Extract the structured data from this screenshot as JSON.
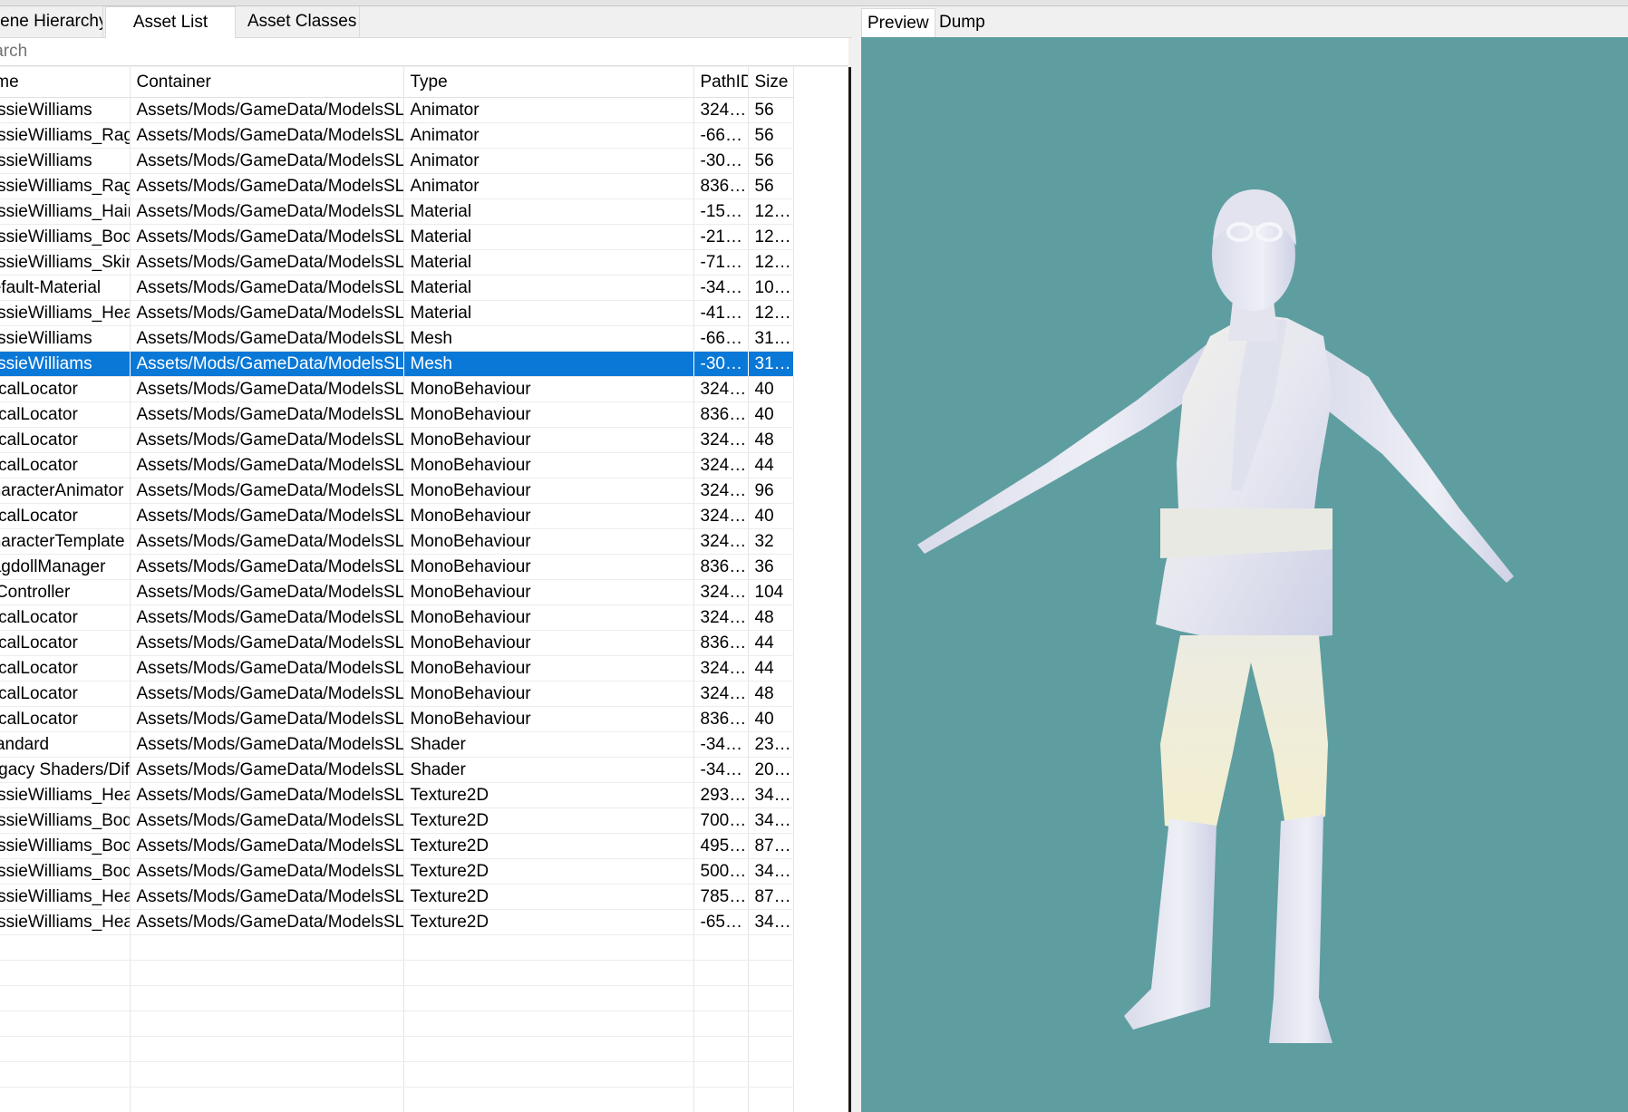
{
  "tabs": {
    "scene_hierarchy": "Scene Hierarchy",
    "asset_list": "Asset List",
    "asset_classes": "Asset Classes"
  },
  "search": {
    "placeholder": "Search"
  },
  "columns": {
    "name": "Name",
    "container": "Container",
    "type": "Type",
    "path_id": "PathID",
    "size": "Size"
  },
  "rows": [
    {
      "name": "JessieWilliams",
      "container": "Assets/Mods/GameData/ModelsSLOD",
      "type": "Animator",
      "path_id": "324…",
      "size": "56"
    },
    {
      "name": "JessieWilliams_Ragdoll",
      "container": "Assets/Mods/GameData/ModelsSLOD",
      "type": "Animator",
      "path_id": "-66…",
      "size": "56"
    },
    {
      "name": "JessieWilliams",
      "container": "Assets/Mods/GameData/ModelsSLOD",
      "type": "Animator",
      "path_id": "-30…",
      "size": "56"
    },
    {
      "name": "JessieWilliams_Ragdoll",
      "container": "Assets/Mods/GameData/ModelsSLOD",
      "type": "Animator",
      "path_id": "836…",
      "size": "56"
    },
    {
      "name": "JessieWilliams_Hair",
      "container": "Assets/Mods/GameData/ModelsSLOD",
      "type": "Material",
      "path_id": "-15…",
      "size": "12…"
    },
    {
      "name": "JessieWilliams_Body",
      "container": "Assets/Mods/GameData/ModelsSLOD",
      "type": "Material",
      "path_id": "-21…",
      "size": "12…"
    },
    {
      "name": "JessieWilliams_Skin",
      "container": "Assets/Mods/GameData/ModelsSLOD",
      "type": "Material",
      "path_id": "-71…",
      "size": "12…"
    },
    {
      "name": "Default-Material",
      "container": "Assets/Mods/GameData/ModelsSLOD",
      "type": "Material",
      "path_id": "-34…",
      "size": "10…"
    },
    {
      "name": "JessieWilliams_Head",
      "container": "Assets/Mods/GameData/ModelsSLOD",
      "type": "Material",
      "path_id": "-41…",
      "size": "12…"
    },
    {
      "name": "JessieWilliams",
      "container": "Assets/Mods/GameData/ModelsSLOD",
      "type": "Mesh",
      "path_id": "-66…",
      "size": "31…"
    },
    {
      "name": "JessieWilliams",
      "container": "Assets/Mods/GameData/ModelsSLOD",
      "type": "Mesh",
      "path_id": "-30…",
      "size": "31…",
      "selected": true
    },
    {
      "name": "LocalLocator",
      "container": "Assets/Mods/GameData/ModelsSLOD",
      "type": "MonoBehaviour",
      "path_id": "324…",
      "size": "40"
    },
    {
      "name": "LocalLocator",
      "container": "Assets/Mods/GameData/ModelsSLOD",
      "type": "MonoBehaviour",
      "path_id": "836…",
      "size": "40"
    },
    {
      "name": "LocalLocator",
      "container": "Assets/Mods/GameData/ModelsSLOD",
      "type": "MonoBehaviour",
      "path_id": "324…",
      "size": "48"
    },
    {
      "name": "LocalLocator",
      "container": "Assets/Mods/GameData/ModelsSLOD",
      "type": "MonoBehaviour",
      "path_id": "324…",
      "size": "44"
    },
    {
      "name": "CharacterAnimator",
      "container": "Assets/Mods/GameData/ModelsSLOD",
      "type": "MonoBehaviour",
      "path_id": "324…",
      "size": "96"
    },
    {
      "name": "LocalLocator",
      "container": "Assets/Mods/GameData/ModelsSLOD",
      "type": "MonoBehaviour",
      "path_id": "324…",
      "size": "40"
    },
    {
      "name": "CharacterTemplate",
      "container": "Assets/Mods/GameData/ModelsSLOD",
      "type": "MonoBehaviour",
      "path_id": "324…",
      "size": "32"
    },
    {
      "name": "RagdollManager",
      "container": "Assets/Mods/GameData/ModelsSLOD",
      "type": "MonoBehaviour",
      "path_id": "836…",
      "size": "36"
    },
    {
      "name": "IKController",
      "container": "Assets/Mods/GameData/ModelsSLOD",
      "type": "MonoBehaviour",
      "path_id": "324…",
      "size": "104"
    },
    {
      "name": "LocalLocator",
      "container": "Assets/Mods/GameData/ModelsSLOD",
      "type": "MonoBehaviour",
      "path_id": "324…",
      "size": "48"
    },
    {
      "name": "LocalLocator",
      "container": "Assets/Mods/GameData/ModelsSLOD",
      "type": "MonoBehaviour",
      "path_id": "836…",
      "size": "44"
    },
    {
      "name": "LocalLocator",
      "container": "Assets/Mods/GameData/ModelsSLOD",
      "type": "MonoBehaviour",
      "path_id": "324…",
      "size": "44"
    },
    {
      "name": "LocalLocator",
      "container": "Assets/Mods/GameData/ModelsSLOD",
      "type": "MonoBehaviour",
      "path_id": "324…",
      "size": "48"
    },
    {
      "name": "LocalLocator",
      "container": "Assets/Mods/GameData/ModelsSLOD",
      "type": "MonoBehaviour",
      "path_id": "836…",
      "size": "40"
    },
    {
      "name": "Standard",
      "container": "Assets/Mods/GameData/ModelsSLOD",
      "type": "Shader",
      "path_id": "-34…",
      "size": "23…"
    },
    {
      "name": "Legacy Shaders/Diffuse",
      "container": "Assets/Mods/GameData/ModelsSLOD",
      "type": "Shader",
      "path_id": "-34…",
      "size": "20…"
    },
    {
      "name": "JessieWilliams_Head",
      "container": "Assets/Mods/GameData/ModelsSLOD",
      "type": "Texture2D",
      "path_id": "293…",
      "size": "34…"
    },
    {
      "name": "JessieWilliams_Body",
      "container": "Assets/Mods/GameData/ModelsSLOD",
      "type": "Texture2D",
      "path_id": "700…",
      "size": "34…"
    },
    {
      "name": "JessieWilliams_Body",
      "container": "Assets/Mods/GameData/ModelsSLOD",
      "type": "Texture2D",
      "path_id": "495…",
      "size": "87…"
    },
    {
      "name": "JessieWilliams_Body",
      "container": "Assets/Mods/GameData/ModelsSLOD",
      "type": "Texture2D",
      "path_id": "500…",
      "size": "34…"
    },
    {
      "name": "JessieWilliams_Head",
      "container": "Assets/Mods/GameData/ModelsSLOD",
      "type": "Texture2D",
      "path_id": "785…",
      "size": "87…"
    },
    {
      "name": "JessieWilliams_Head",
      "container": "Assets/Mods/GameData/ModelsSLOD",
      "type": "Texture2D",
      "path_id": "-65…",
      "size": "34…"
    }
  ],
  "preview": {
    "tab_preview": "Preview",
    "tab_dump": "Dump"
  },
  "colors": {
    "selection": "#0a78d7",
    "viewport_bg": "#5f9ea0",
    "model": "#e8e9f2"
  }
}
